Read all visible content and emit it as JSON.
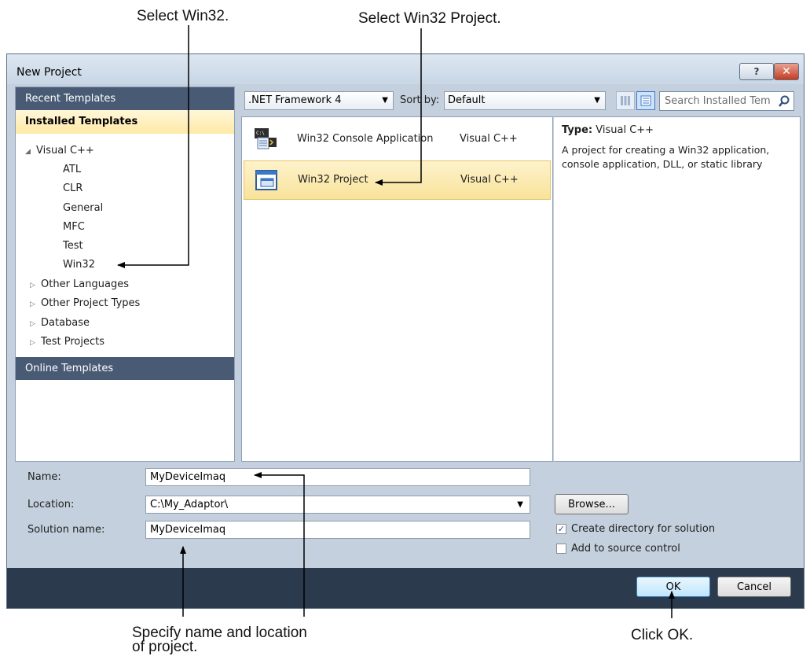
{
  "callouts": {
    "select_win32": "Select Win32.",
    "select_win32_project": "Select Win32 Project.",
    "specify_name_line1": "Specify name and location",
    "specify_name_line2": "of project.",
    "click_ok": "Click OK."
  },
  "window": {
    "title": "New Project",
    "help_label": "?",
    "close_label": "✕"
  },
  "left_panel": {
    "recent_templates": "Recent Templates",
    "installed_templates": "Installed Templates",
    "online_templates": "Online Templates",
    "tree": {
      "visual_cpp": "Visual C++",
      "children": [
        "ATL",
        "CLR",
        "General",
        "MFC",
        "Test",
        "Win32"
      ],
      "collapsed": [
        "Other Languages",
        "Other Project Types",
        "Database",
        "Test Projects"
      ]
    }
  },
  "toolbar": {
    "framework": ".NET Framework 4",
    "sort_label": "Sort by:",
    "sort_value": "Default",
    "search_placeholder": "Search Installed Tem"
  },
  "templates": [
    {
      "name": "Win32 Console Application",
      "language": "Visual C++",
      "icon": "console-app-icon",
      "selected": false
    },
    {
      "name": "Win32 Project",
      "language": "Visual C++",
      "icon": "win32-project-icon",
      "selected": true
    }
  ],
  "details": {
    "type_label": "Type:",
    "type_value": "Visual C++",
    "description": "A project for creating a Win32 application, console application, DLL, or static library"
  },
  "form": {
    "name_label": "Name:",
    "name_value": "MyDeviceImaq",
    "location_label": "Location:",
    "location_value": "C:\\My_Adaptor\\",
    "solution_label": "Solution name:",
    "solution_value": "MyDeviceImaq",
    "browse_label": "Browse...",
    "create_dir_label": "Create directory for solution",
    "create_dir_checked": true,
    "source_control_label": "Add to source control",
    "source_control_checked": false
  },
  "buttons": {
    "ok": "OK",
    "cancel": "Cancel"
  },
  "colors": {
    "dialog_bg": "#c4d0dd",
    "section_header": "#495b74",
    "selection": "#f9e39a",
    "footer": "#2b3a4d"
  }
}
